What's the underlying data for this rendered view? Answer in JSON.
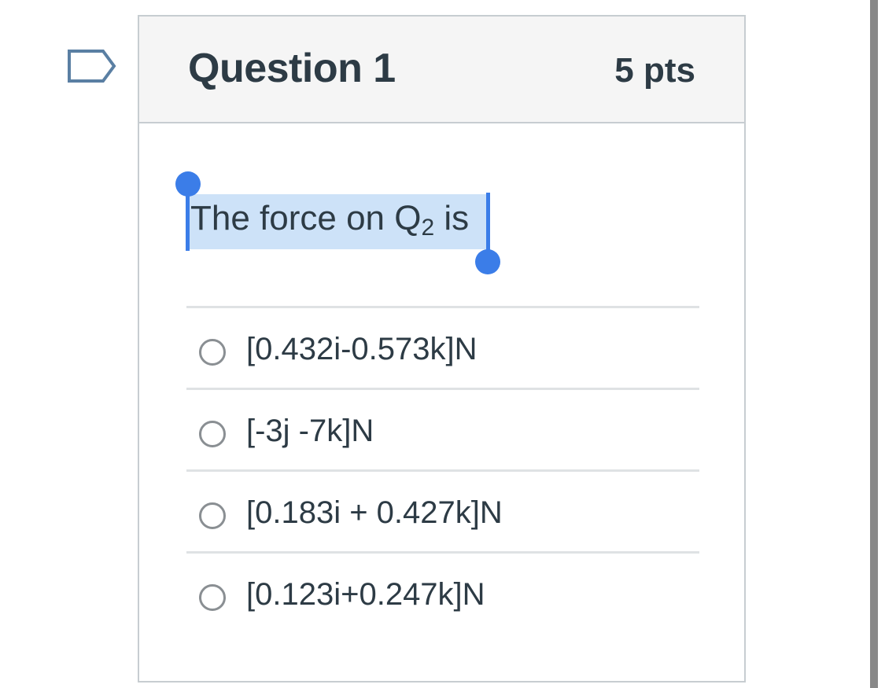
{
  "question": {
    "title": "Question 1",
    "points": "5 pts",
    "text_prefix": "The force on Q",
    "text_subscript": "2",
    "text_suffix": " is"
  },
  "answers": [
    {
      "label": "[0.432i-0.573k]N",
      "selected": false
    },
    {
      "label": "[-3j -7k]N",
      "selected": false
    },
    {
      "label": "[0.183i + 0.427k]N",
      "selected": false
    },
    {
      "label": "[0.123i+0.247k]N",
      "selected": false
    }
  ],
  "icons": {
    "flag": "flag-question-icon"
  },
  "colors": {
    "text": "#2d3b45",
    "header_bg": "#f5f5f5",
    "border": "#c7cdd1",
    "selection_highlight": "#cde2f8",
    "selection_handle": "#3b7de8",
    "radio_border": "#8a8f93"
  }
}
